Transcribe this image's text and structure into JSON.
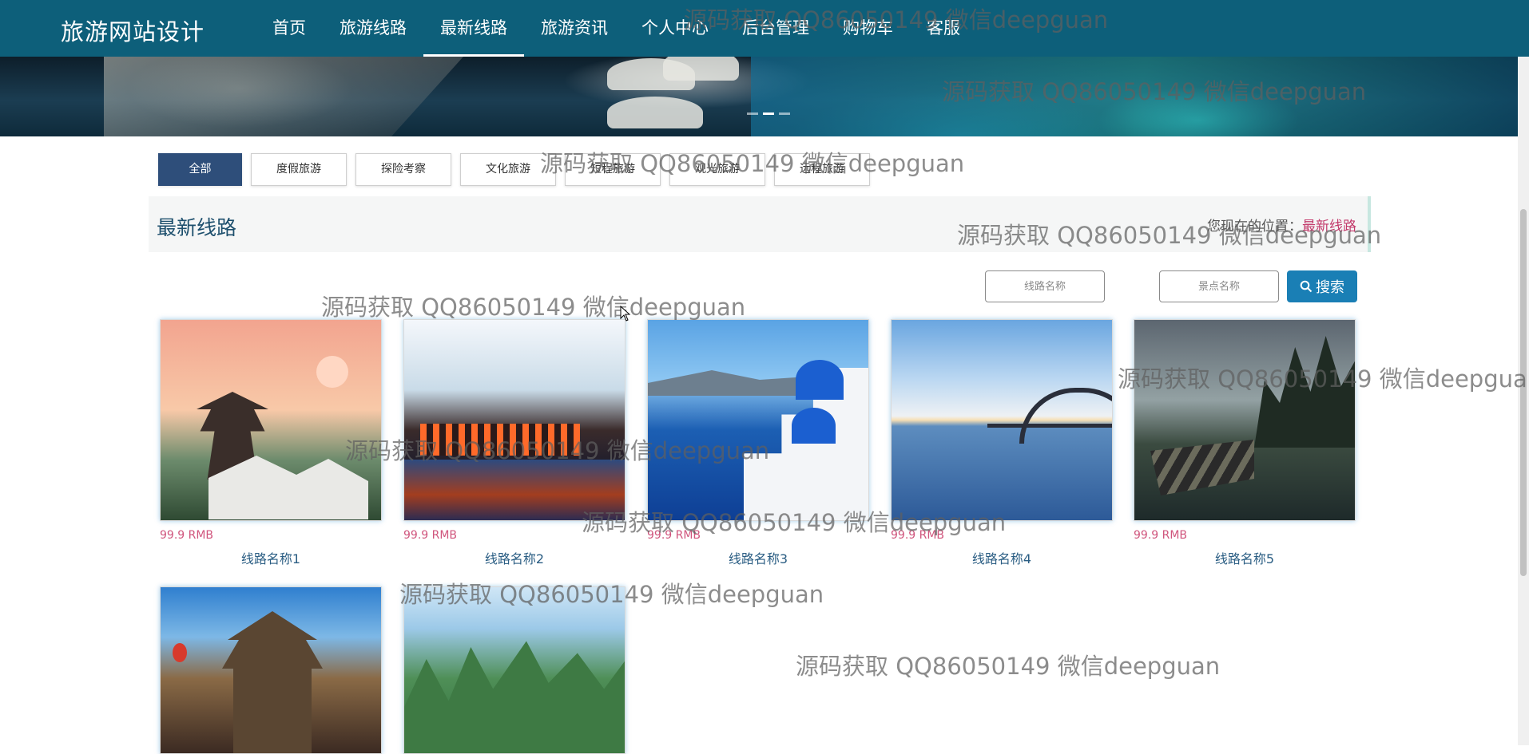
{
  "header": {
    "brand": "旅游网站设计",
    "nav": [
      {
        "label": "首页"
      },
      {
        "label": "旅游线路"
      },
      {
        "label": "最新线路",
        "active": true
      },
      {
        "label": "旅游资讯"
      },
      {
        "label": "个人中心"
      },
      {
        "label": "后台管理"
      },
      {
        "label": "购物车"
      },
      {
        "label": "客服"
      }
    ]
  },
  "banner": {
    "slide_count": 3,
    "active_slide": 1
  },
  "filters": [
    "全部",
    "度假旅游",
    "探险考察",
    "文化旅游",
    "短程旅游",
    "观光旅游",
    "远程旅游"
  ],
  "section": {
    "title": "最新线路",
    "breadcrumb_prefix": "您现在的位置：",
    "breadcrumb_current": "最新线路"
  },
  "search": {
    "route_placeholder": "线路名称",
    "spot_placeholder": "景点名称",
    "button_label": "搜索"
  },
  "cards": [
    {
      "price": "99.9 RMB",
      "name": "线路名称1"
    },
    {
      "price": "99.9 RMB",
      "name": "线路名称2"
    },
    {
      "price": "99.9 RMB",
      "name": "线路名称3"
    },
    {
      "price": "99.9 RMB",
      "name": "线路名称4"
    },
    {
      "price": "99.9 RMB",
      "name": "线路名称5"
    },
    {
      "price": "",
      "name": ""
    },
    {
      "price": "",
      "name": ""
    }
  ],
  "watermark": "源码获取 QQ86050149 微信deepguan",
  "colors": {
    "nav_bg": "#0d5f7a",
    "filter_active": "#2e4e7a",
    "search_button": "#1a7fb5",
    "price": "#d0557d",
    "link": "#2a5d83"
  }
}
